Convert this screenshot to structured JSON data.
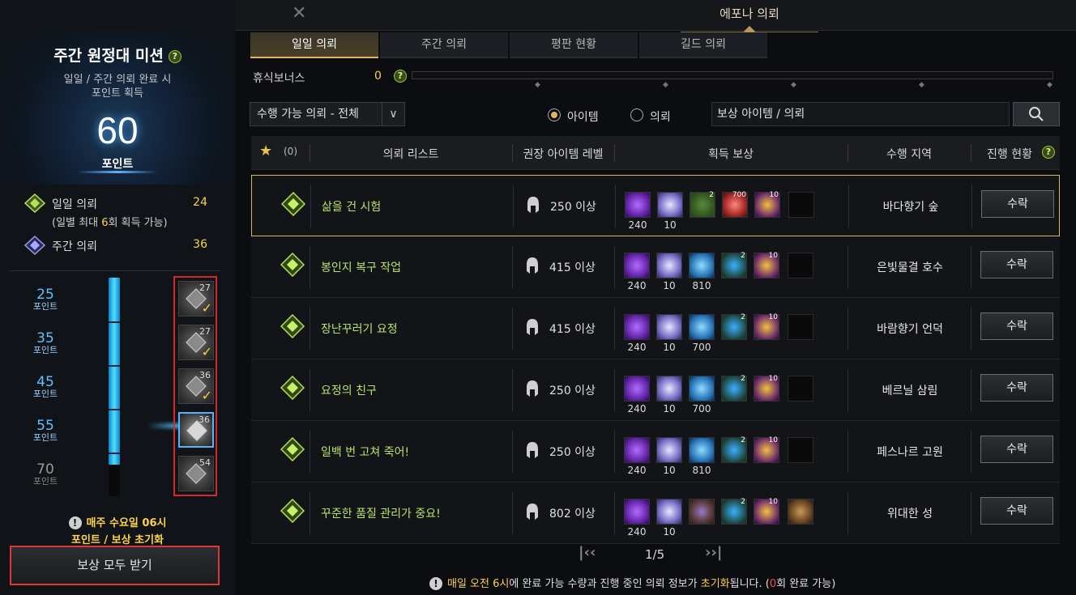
{
  "window": {
    "title": "에포나 의뢰"
  },
  "mission": {
    "title": "주간 원정대 미션",
    "desc_line1": "일일 / 주간 의뢰 완료 시",
    "desc_line2": "포인트 획득",
    "points": "60",
    "points_unit": "포인트",
    "daily_label": "일일 의뢰",
    "daily_value": "24",
    "daily_note_pre": "(일별 최대 ",
    "daily_note_num": "6",
    "daily_note_post": "회 획득 가능)",
    "weekly_label": "주간 의뢰",
    "weekly_value": "36",
    "reset_line1": "매주 수요일 06시",
    "reset_line2": "포인트 / 보상 초기화",
    "claim_all": "보상 모두 받기"
  },
  "tiers": [
    {
      "points": "25",
      "unit": "포인트",
      "reward_count": "27",
      "claimed": true
    },
    {
      "points": "35",
      "unit": "포인트",
      "reward_count": "27",
      "claimed": true
    },
    {
      "points": "45",
      "unit": "포인트",
      "reward_count": "36",
      "claimed": true
    },
    {
      "points": "55",
      "unit": "포인트",
      "reward_count": "36",
      "claimed": false
    },
    {
      "points": "70",
      "unit": "포인트",
      "reward_count": "54",
      "claimed": false
    }
  ],
  "gauge_fill_fraction": 0.857,
  "tabs": [
    "일일 의뢰",
    "주간 의뢰",
    "평판 현황",
    "길드 의뢰"
  ],
  "rest_bonus": {
    "label": "휴식보너스",
    "value": "0"
  },
  "filter": {
    "select": "수행 가능 의뢰 - 전체",
    "radio_item": "아이템",
    "radio_quest": "의뢰",
    "search_placeholder": "보상 아이템 / 의뢰"
  },
  "table_header": {
    "fav_count": "(0)",
    "list": "의뢰 리스트",
    "level": "권장 아이템 레벨",
    "reward": "획득 보상",
    "region": "수행 지역",
    "status": "진행 현황"
  },
  "quests": [
    {
      "name": "삶을 건 시험",
      "level": "250 이상",
      "region": "바다향기 숲",
      "accept": "수락",
      "rewards": [
        {
          "type": "purple",
          "count": "240"
        },
        {
          "type": "diamond",
          "count": "10"
        },
        {
          "type": "green",
          "badge": "2"
        },
        {
          "type": "red",
          "badge": "700"
        },
        {
          "type": "gold",
          "badge": "10"
        },
        {
          "type": "empty"
        }
      ]
    },
    {
      "name": "봉인지 복구 작업",
      "level": "415 이상",
      "region": "은빛물결 호수",
      "accept": "수락",
      "rewards": [
        {
          "type": "purple",
          "count": "240"
        },
        {
          "type": "diamond",
          "count": "10"
        },
        {
          "type": "crystal",
          "count": "810"
        },
        {
          "type": "blue-item",
          "badge": "2"
        },
        {
          "type": "gold",
          "badge": "10"
        },
        {
          "type": "empty"
        }
      ]
    },
    {
      "name": "장난꾸러기 요정",
      "level": "415 이상",
      "region": "바람향기 언덕",
      "accept": "수락",
      "rewards": [
        {
          "type": "purple",
          "count": "240"
        },
        {
          "type": "diamond",
          "count": "10"
        },
        {
          "type": "crystal",
          "count": "700"
        },
        {
          "type": "blue-item",
          "badge": "2"
        },
        {
          "type": "gold",
          "badge": "10"
        },
        {
          "type": "empty"
        }
      ]
    },
    {
      "name": "요정의 친구",
      "level": "250 이상",
      "region": "베르닐 삼림",
      "accept": "수락",
      "rewards": [
        {
          "type": "purple",
          "count": "240"
        },
        {
          "type": "diamond",
          "count": "10"
        },
        {
          "type": "crystal",
          "count": "700"
        },
        {
          "type": "blue-item",
          "badge": "2"
        },
        {
          "type": "gold",
          "badge": "10"
        },
        {
          "type": "empty"
        }
      ]
    },
    {
      "name": "일백 번 고쳐 죽어!",
      "level": "250 이상",
      "region": "페스나르 고원",
      "accept": "수락",
      "rewards": [
        {
          "type": "purple",
          "count": "240"
        },
        {
          "type": "diamond",
          "count": "10"
        },
        {
          "type": "crystal",
          "count": "810"
        },
        {
          "type": "blue-item",
          "badge": "2"
        },
        {
          "type": "gold",
          "badge": "10"
        },
        {
          "type": "empty"
        }
      ]
    },
    {
      "name": "꾸준한 품질 관리가 중요!",
      "level": "802 이상",
      "region": "위대한 성",
      "accept": "수락",
      "rewards": [
        {
          "type": "purple",
          "count": "240"
        },
        {
          "type": "diamond",
          "count": "10"
        },
        {
          "type": "ore"
        },
        {
          "type": "blue-item",
          "badge": "2"
        },
        {
          "type": "gold",
          "badge": "10"
        },
        {
          "type": "chest"
        }
      ]
    }
  ],
  "pager": {
    "text": "1/5"
  },
  "footer": {
    "a": "매일 오전 6시",
    "b": "에 완료 가능 수량과 진행 중인 의뢰 정보가 ",
    "c": "초기화",
    "d": "됩니다. (",
    "e": "0",
    "f": "회 완료 가능)"
  }
}
